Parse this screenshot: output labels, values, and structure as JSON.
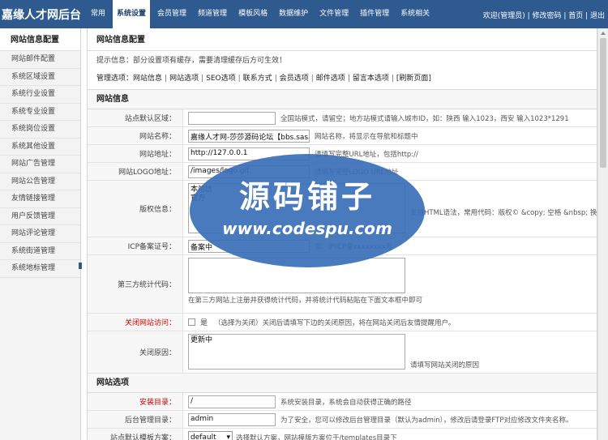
{
  "header": {
    "logo": "嘉缘人才网后台",
    "nav": [
      "常用",
      "系统设置",
      "会员管理",
      "频道管理",
      "模板风格",
      "数据维护",
      "文件管理",
      "插件管理",
      "系统相关"
    ],
    "active_index": 1,
    "right_text": "欢迎(管理员) | 修改密码 | 首页 | 退出"
  },
  "sidebar": {
    "title": "网站信息配置",
    "items": [
      "网站邮件配置",
      "系统区域设置",
      "系统行业设置",
      "系统专业设置",
      "系统岗位设置",
      "系统其他设置",
      "网站广告管理",
      "网站公告管理",
      "友情链接管理",
      "用户反馈管理",
      "网站评论管理",
      "系统街道管理",
      "系统地标管理"
    ]
  },
  "main": {
    "title": "网站信息配置",
    "tip": "提示信息：部分设置项有缓存，需要清理缓存后方可生效！",
    "options_label": "管理选项：",
    "options": [
      "网站信息",
      "网站选项",
      "SEO选项",
      "联系方式",
      "会员选项",
      "邮件选项",
      "留言本选项",
      "[刷新页面]"
    ],
    "sections": {
      "site_info": "网站信息",
      "site_options": "网站选项"
    },
    "fields": {
      "default_area": {
        "label": "站点默认区域：",
        "value": "",
        "hint": "全国站模式，请留空；地方站模式请输入城市ID，如：陕西 输入1023，西安 输入1023*1291"
      },
      "site_name": {
        "label": "网站名称：",
        "value": "嘉缘人才网-莎莎源码论坛【bbs.sasa",
        "hint": "网站名称，将显示在导航和标题中"
      },
      "site_url": {
        "label": "网站地址：",
        "value": "http://127.0.0.1",
        "hint": "请填写完整URL地址，包括http://"
      },
      "logo_url": {
        "label": "网站LOGO地址：",
        "value": "/images/logo.gif",
        "hint": "请填写完整LOGO URL地址"
      },
      "copyright": {
        "label": "版权信息：",
        "value": "本站信\n官方",
        "hint": "支持HTML语法，常用代码：版权© &copy; 空格 &nbsp; 换行"
      },
      "icp": {
        "label": "ICP备案证号：",
        "value": "备案中",
        "hint": "如：沪ICP备xxxxxxxx号"
      },
      "stats_code": {
        "label": "第三方统计代码：",
        "value": "",
        "hint": "在第三方网站上注册并获得统计代码，并将统计代码粘贴在下面文本框中即可"
      },
      "close_site": {
        "label": "关闭网站访问：",
        "checkbox_label": "是",
        "hint": "（选择为关闭）关闭后请填写下边的关闭原因，将在网站关闭后友情提醒用户。"
      },
      "close_reason": {
        "label": "关闭原因：",
        "value": "更新中",
        "hint": "请填写网站关闭的原因"
      },
      "install_dir": {
        "label": "安装目录：",
        "value": "/",
        "hint": "系统安装目录，系统会自动获得正确的路径"
      },
      "admin_dir": {
        "label": "后台管理目录：",
        "value": "admin",
        "hint": "为了安全，您可以修改后台管理目录（默认为admin），修改后请登录FTP对应修改文件夹名称。"
      },
      "template": {
        "label": "站点默认模板方案：",
        "value": "default",
        "hint": "选择默认方案，网站模版方案位于/templates目录下"
      }
    }
  },
  "watermark": {
    "title": "源码铺子",
    "url": "www.codespu.com",
    "color": "#3a6fb8"
  },
  "colors": {
    "header_bg": "#2e5a8f",
    "label_red": "#cc0000"
  }
}
